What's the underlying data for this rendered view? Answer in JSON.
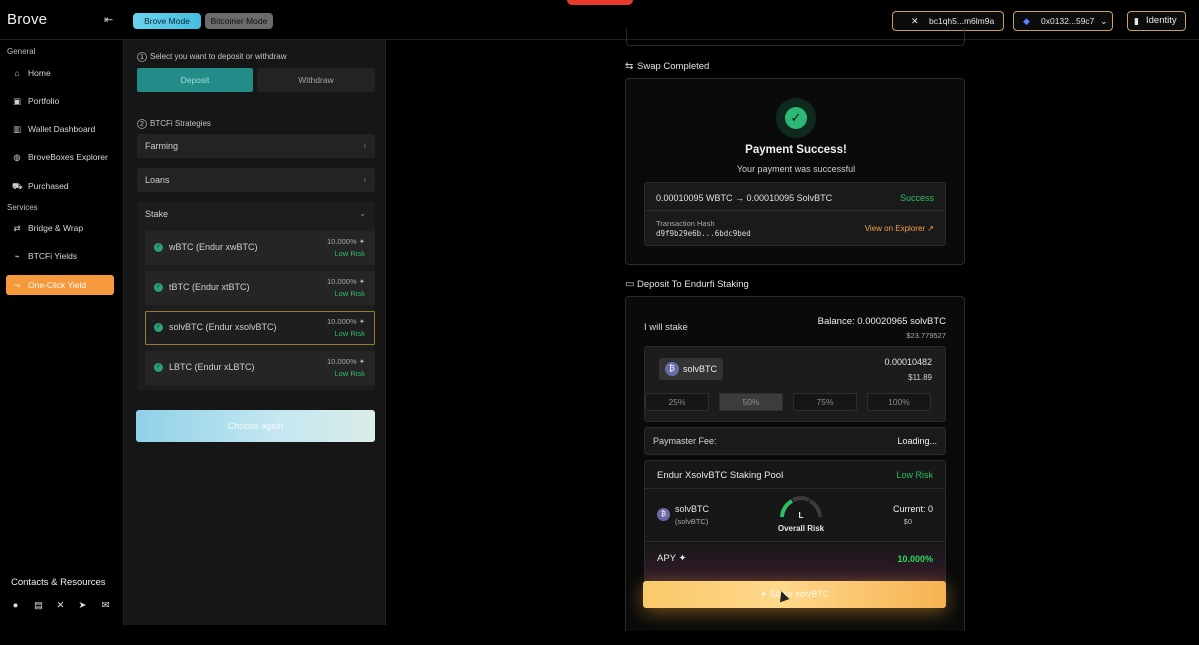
{
  "app": {
    "brand": "Brove",
    "modes": [
      "Brove Mode",
      "Bitcoiner Mode"
    ]
  },
  "header": {
    "btc_address": "bc1qh5...m6lm9a",
    "eth_address": "0x0132...59c7",
    "identity_label": "Identity"
  },
  "sidebar": {
    "general_label": "General",
    "general_items": [
      {
        "label": "Home",
        "icon": "home-icon"
      },
      {
        "label": "Portfolio",
        "icon": "briefcase-icon"
      },
      {
        "label": "Wallet Dashboard",
        "icon": "chart-icon"
      },
      {
        "label": "BroveBoxes Explorer",
        "icon": "globe-icon"
      },
      {
        "label": "Purchased",
        "icon": "cart-icon"
      }
    ],
    "services_label": "Services",
    "services_items": [
      {
        "label": "Bridge & Wrap",
        "icon": "bridge-icon"
      },
      {
        "label": "BTCFi Yields",
        "icon": "yield-icon"
      },
      {
        "label": "One-Click Yield",
        "icon": "one-click-icon"
      }
    ],
    "active_item": "One-Click Yield",
    "contacts_label": "Contacts & Resources",
    "social_icons": [
      "github-icon",
      "book-icon",
      "x-icon",
      "telegram-icon",
      "mail-icon"
    ]
  },
  "panel": {
    "step1": {
      "num": "1",
      "label": "Select you want to deposit or withdraw"
    },
    "deposit_label": "Deposit",
    "withdraw_label": "Withdraw",
    "step2": {
      "num": "2",
      "label": "BTCFi Strategies"
    },
    "accordions": [
      "Farming",
      "Loans",
      "Stake"
    ],
    "stake_options": [
      {
        "name": "wBTC (Endur xwBTC)",
        "apy": "10.000%",
        "risk": "Low Risk",
        "selected": false
      },
      {
        "name": "tBTC (Endur xtBTC)",
        "apy": "10.000%",
        "risk": "Low Risk",
        "selected": false
      },
      {
        "name": "solvBTC (Endur xsolvBTC)",
        "apy": "10.000%",
        "risk": "Low Risk",
        "selected": true
      },
      {
        "name": "LBTC (Endur xLBTC)",
        "apy": "10.000%",
        "risk": "Low Risk",
        "selected": false
      }
    ],
    "choose_again": "Choose again"
  },
  "swap": {
    "title": "Swap Completed",
    "payment_title": "Payment Success!",
    "payment_sub": "Your payment was successful",
    "tx_summary": "0.00010095 WBTC → 0.00010095 SolvBTC",
    "tx_status": "Success",
    "tx_hash_label": "Transaction Hash",
    "tx_hash": "d9f9b29e6b...6bdc9bed",
    "explorer_link": "View on Explorer ↗"
  },
  "deposit": {
    "title": "Deposit To Endurfi Staking",
    "will_stake": "I will stake",
    "balance": "Balance: 0.00020965 solvBTC",
    "balance_usd": "$23.779527",
    "token": "solvBTC",
    "amount": "0.00010482",
    "amount_usd": "$11.89",
    "percent_buttons": [
      "25%",
      "50%",
      "75%",
      "100%"
    ],
    "percent_selected": "50%",
    "paymaster_label": "Paymaster Fee:",
    "paymaster_value": "Loading...",
    "pool_name": "Endur XsolvBTC Staking Pool",
    "pool_risk": "Low Risk",
    "pool_token": "solvBTC",
    "pool_token_sub": "(solvBTC)",
    "gauge_letter": "L",
    "gauge_label": "Overall Risk",
    "current": "Current: 0",
    "current_usd": "$0",
    "apy_label": "APY",
    "apy_value": "10.000%",
    "stake_button": "Stake solvBTC"
  },
  "colors": {
    "accent_orange": "#f6983c",
    "success_green": "#2bbf63",
    "teal": "#228c88",
    "gold_border": "#c8a25a"
  }
}
